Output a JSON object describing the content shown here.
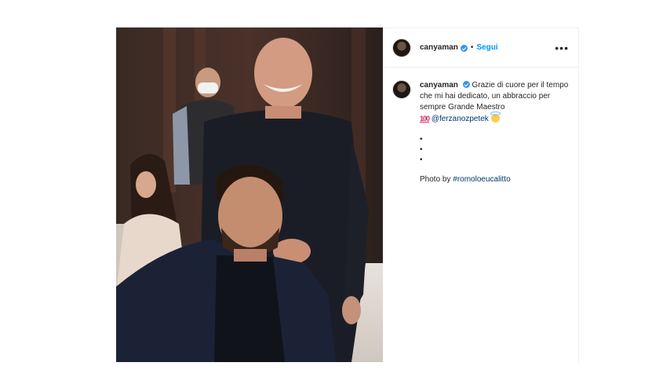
{
  "post": {
    "username": "canyaman",
    "separator": "•",
    "follow_label": "Segui",
    "more_label": "•••",
    "caption": {
      "username": "canyaman",
      "text": "Grazie di cuore per il tempo che mi hai dedicato, un abbraccio per sempre Grande Maestro",
      "emoji_100": "100",
      "mention": "@ferzanozpetek",
      "dots": [
        "•",
        "•",
        "•"
      ],
      "credit_prefix": "Photo by ",
      "hashtag": "#romoloeucalitto"
    }
  },
  "colors": {
    "accent": "#0095f6",
    "verified": "#3897f0",
    "link": "#00376b",
    "text": "#262626"
  }
}
